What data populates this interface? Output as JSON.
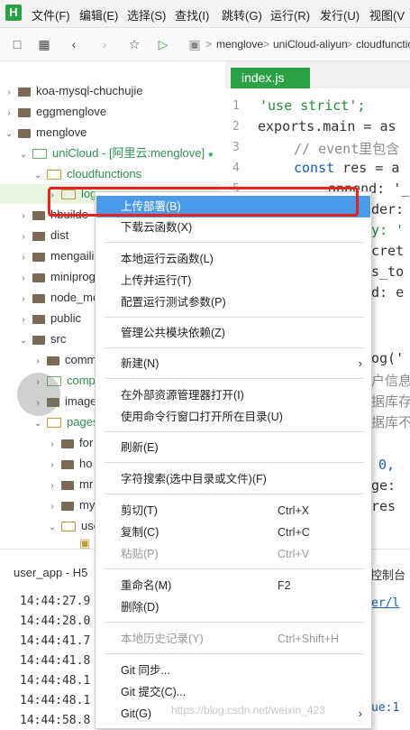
{
  "menubar": {
    "logo": "H",
    "items": [
      "文件(F)",
      "编辑(E)",
      "选择(S)",
      "查找(I)",
      "跳转(G)",
      "运行(R)",
      "发行(U)",
      "视图(V"
    ]
  },
  "toolbar": {
    "crumbs": [
      "menglove",
      "uniCloud-aliyun",
      "cloudfunctio"
    ]
  },
  "tree": {
    "items": [
      {
        "label": "koa-mysql-chuchujie"
      },
      {
        "label": "eggmenglove"
      },
      {
        "label": "menglove"
      },
      {
        "label": "uniCloud - [阿里云:menglove]"
      },
      {
        "label": "cloudfunctions"
      },
      {
        "label": "log"
      },
      {
        "label": "hbuilde"
      },
      {
        "label": "dist"
      },
      {
        "label": "mengaili"
      },
      {
        "label": "miniprog"
      },
      {
        "label": "node_mo"
      },
      {
        "label": "public"
      },
      {
        "label": "src"
      },
      {
        "label": "comm"
      },
      {
        "label": "comp"
      },
      {
        "label": "image"
      },
      {
        "label": "pages"
      },
      {
        "label": "for"
      },
      {
        "label": "ho"
      },
      {
        "label": "mr"
      },
      {
        "label": "my"
      },
      {
        "label": "use"
      }
    ]
  },
  "editor": {
    "tab": "index.js",
    "line_numbers": [
      "1",
      "2",
      "3",
      "4",
      "5"
    ],
    "code": {
      "l1": "'use strict';",
      "l2_kw": "exports.main = as",
      "l3": "// event里包含",
      "l4_kw": "const",
      "l4_rest": " res = a",
      "l5": "append: '_",
      "r1": "der:",
      "r2": "y: '",
      "r3": "cret",
      "r4": "s_to",
      "r5": "d: e",
      "r6": "og('",
      "r7": "户信息",
      "r8": "据库存",
      "r9": "据库不",
      "r10": "0,",
      "r11": "ge:",
      "r12": "res"
    }
  },
  "console": {
    "title": "user_app - H5",
    "right_label": "控制台",
    "path_frag": "er/l",
    "last_frag": "ue:1",
    "timestamps": [
      "14:44:27.9",
      "14:44:28.0",
      "14:44:41.7",
      "14:44:41.8",
      "14:44:48.1",
      "14:44:48.1",
      "14:44:58.8"
    ],
    "watermark": "https://blog.csdn.net/weixin_423"
  },
  "context_menu": {
    "items": [
      {
        "label": "上传部署(B)",
        "shortcut": "",
        "disabled": false,
        "highlighted": true
      },
      {
        "label": "下载云函数(X)",
        "shortcut": "",
        "disabled": false
      },
      {
        "label": "本地运行云函数(L)",
        "shortcut": "",
        "disabled": false
      },
      {
        "label": "上传并运行(T)",
        "shortcut": "",
        "disabled": false
      },
      {
        "label": "配置运行测试参数(P)",
        "shortcut": "",
        "disabled": false
      },
      {
        "label": "管理公共模块依赖(Z)",
        "shortcut": "",
        "disabled": false
      },
      {
        "label": "新建(N)",
        "shortcut": "",
        "disabled": false,
        "submenu": true
      },
      {
        "label": "在外部资源管理器打开(I)",
        "shortcut": "",
        "disabled": false
      },
      {
        "label": "使用命令行窗口打开所在目录(U)",
        "shortcut": "",
        "disabled": false
      },
      {
        "label": "刷新(E)",
        "shortcut": "",
        "disabled": false
      },
      {
        "label": "字符搜索(选中目录或文件)(F)",
        "shortcut": "",
        "disabled": false
      },
      {
        "label": "剪切(T)",
        "shortcut": "Ctrl+X",
        "disabled": false
      },
      {
        "label": "复制(C)",
        "shortcut": "Ctrl+C",
        "disabled": false
      },
      {
        "label": "粘贴(P)",
        "shortcut": "Ctrl+V",
        "disabled": true
      },
      {
        "label": "重命名(M)",
        "shortcut": "F2",
        "disabled": false
      },
      {
        "label": "删除(D)",
        "shortcut": "",
        "disabled": false
      },
      {
        "label": "本地历史记录(Y)",
        "shortcut": "Ctrl+Shift+H",
        "disabled": true
      },
      {
        "label": "Git 同步...",
        "shortcut": "",
        "disabled": false
      },
      {
        "label": "Git 提交(C)...",
        "shortcut": "",
        "disabled": false
      },
      {
        "label": "Git(G)",
        "shortcut": "",
        "disabled": false,
        "submenu": true
      }
    ]
  },
  "colors": {
    "accent": "#2ba245",
    "highlight": "#4a9bea",
    "annotation_red": "#e8231f"
  }
}
